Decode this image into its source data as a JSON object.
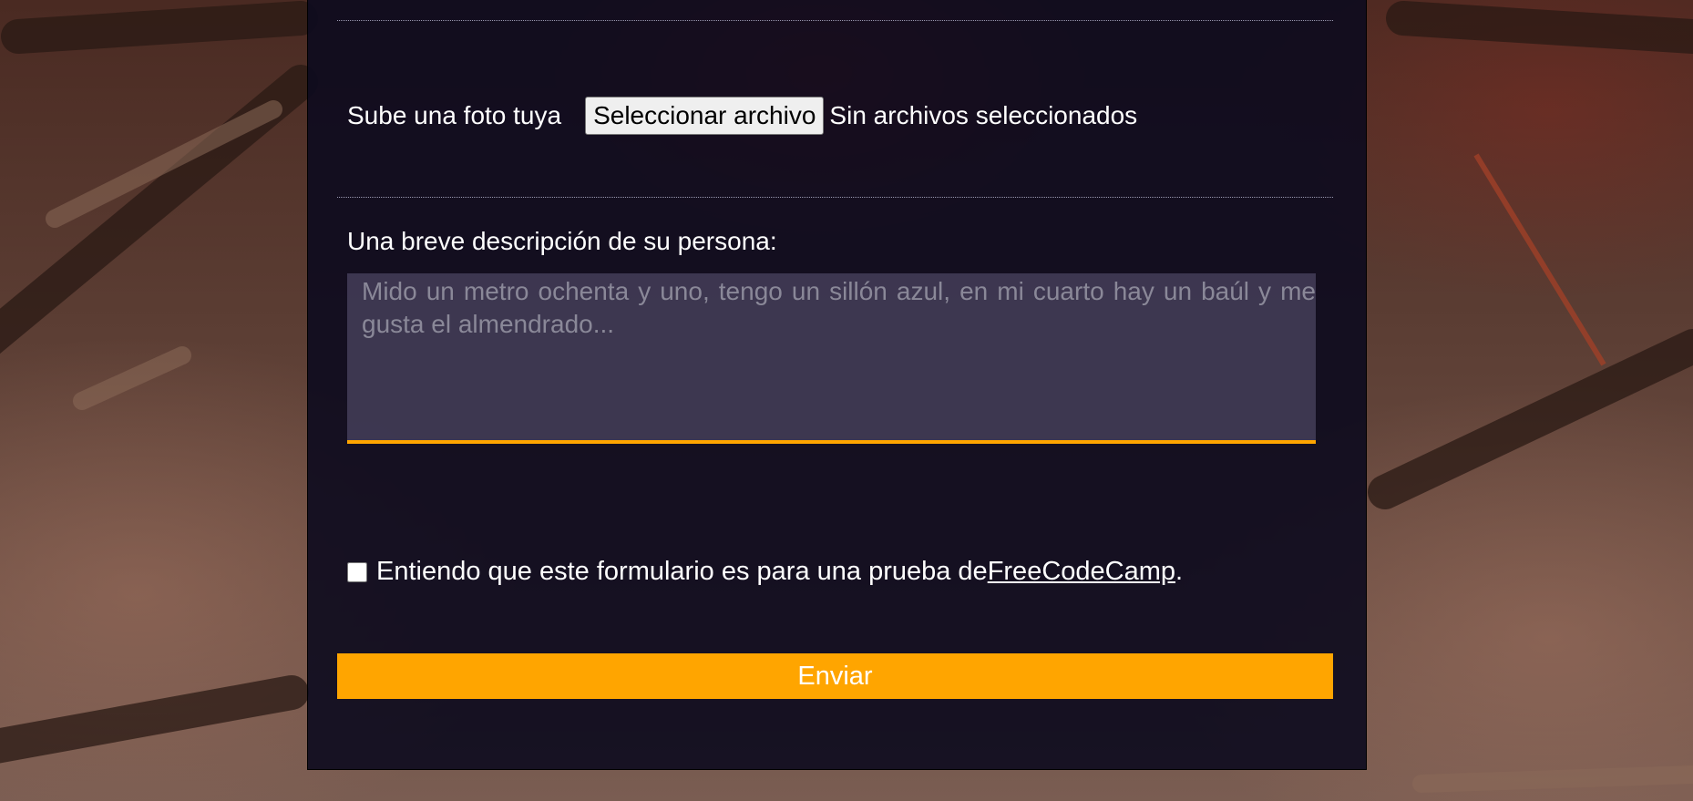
{
  "photo_section": {
    "label": "Sube una foto tuya",
    "button_label": "Seleccionar archivo",
    "status": "Sin archivos seleccionados"
  },
  "description_section": {
    "label": "Una breve descripción de su persona:",
    "placeholder": "Mido un metro ochenta y uno, tengo un sillón azul, en mi cuarto hay un baúl y me gusta el almendrado...",
    "value": ""
  },
  "consent": {
    "text": "Entiendo que este formulario es para una prueba de ",
    "link_text": "FreeCodeCamp",
    "suffix": ".",
    "checked": false
  },
  "submit": {
    "label": "Enviar"
  },
  "colors": {
    "accent": "#ffa500",
    "panel": "#0c0a1e"
  }
}
